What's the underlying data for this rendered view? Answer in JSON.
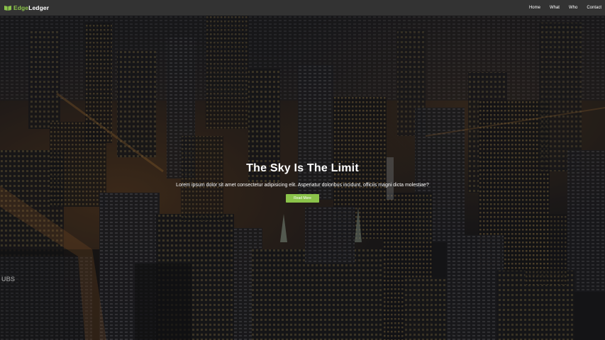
{
  "nav": {
    "brand_edge": "Edge",
    "brand_rest": "Ledger",
    "brand_icon": "book-icon",
    "links": [
      "Home",
      "What",
      "Who",
      "Contact"
    ]
  },
  "hero": {
    "title": "The Sky Is The Limit",
    "text": "Lorem ipsum dolor sit amet consectetur adipisicing elit. Asperiatur doloribus incidunt, officiis magni dicta molestiae?",
    "button": "Read More",
    "background": "night-city-aerial-photo",
    "sign_text": "UBS"
  },
  "colors": {
    "accent": "#8bc34a",
    "navbar": "#333333",
    "text": "#ffffff"
  }
}
